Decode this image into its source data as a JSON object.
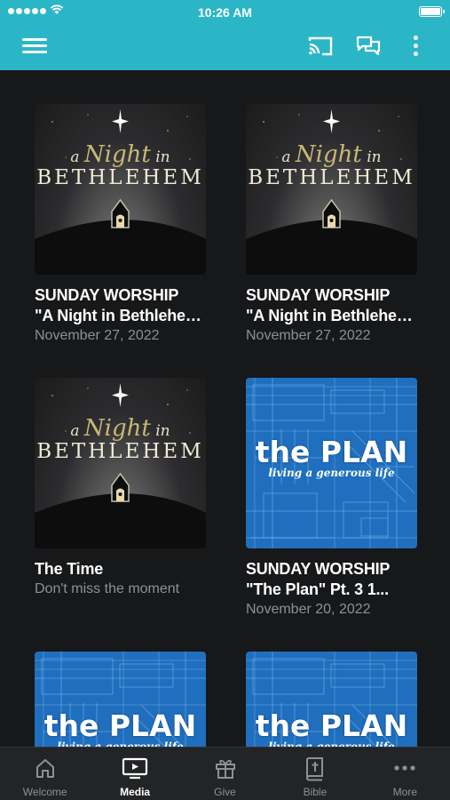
{
  "status_bar": {
    "time": "10:26 AM"
  },
  "app_bar": {
    "icons": [
      "menu-icon",
      "cast-icon",
      "chat-icon",
      "more-vertical-icon"
    ]
  },
  "colors": {
    "header": "#2bb6c8",
    "background": "#17181a",
    "tab_bar": "#232426",
    "muted_text": "#8e9094",
    "plan_blue": "#1f6fbe"
  },
  "artwork": {
    "bethlehem": {
      "a": "a",
      "night": "Night",
      "in": "in",
      "word": "BETHLEHEM"
    },
    "plan": {
      "title": "the PLAN",
      "tagline": "living a generous life"
    }
  },
  "media_items": [
    {
      "line1": "SUNDAY WORSHIP",
      "line2": "\"A Night in Bethlehem\"",
      "meta": "November 27, 2022"
    },
    {
      "line1": "SUNDAY WORSHIP",
      "line2": "\"A Night in Bethlehem\"",
      "meta": "November 27, 2022"
    },
    {
      "line1": "The Time",
      "meta": "Don't miss the moment"
    },
    {
      "line1": "SUNDAY WORSHIP",
      "line2": "\"The Plan\" Pt. 3 1...",
      "meta": "November 20, 2022"
    },
    {},
    {}
  ],
  "tabs": [
    {
      "label": "Welcome",
      "icon": "home-icon"
    },
    {
      "label": "Media",
      "icon": "tv-icon",
      "active": true
    },
    {
      "label": "Give",
      "icon": "gift-icon"
    },
    {
      "label": "Bible",
      "icon": "bible-icon"
    },
    {
      "label": "More",
      "icon": "more-horizontal-icon"
    }
  ]
}
